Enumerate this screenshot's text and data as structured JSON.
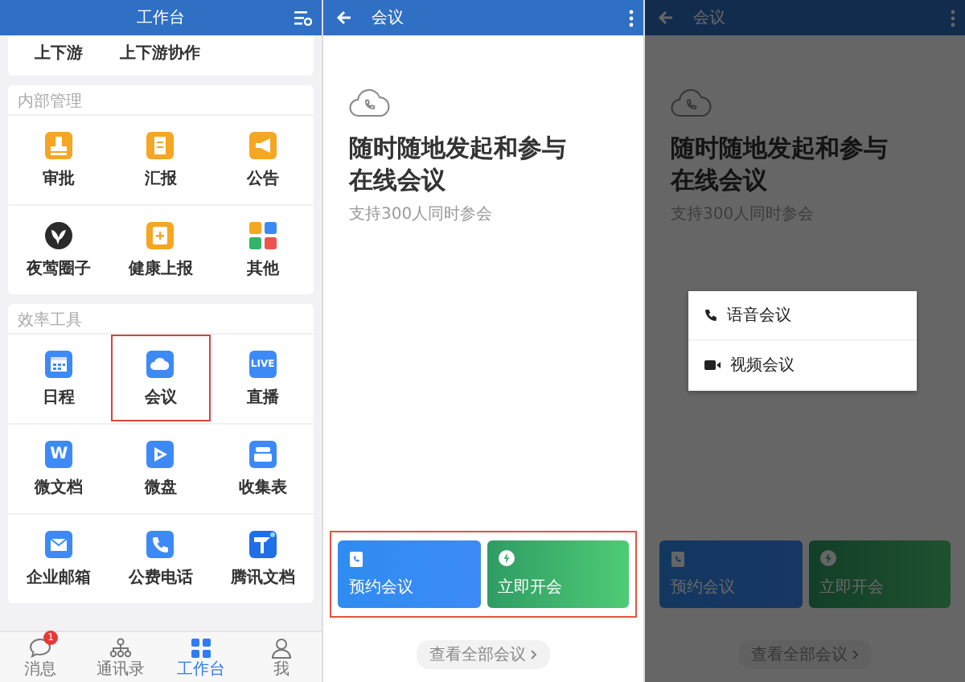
{
  "screens": [
    {
      "kind": "workbench",
      "title": "工作台",
      "top_items": [
        "上下游",
        "上下游协作"
      ],
      "sections": [
        {
          "title": "内部管理",
          "apps": [
            {
              "label": "审批",
              "highlighted": false
            },
            {
              "label": "汇报",
              "highlighted": false
            },
            {
              "label": "公告",
              "highlighted": false
            },
            {
              "label": "夜莺圈子",
              "highlighted": false
            },
            {
              "label": "健康上报",
              "highlighted": false
            },
            {
              "label": "其他",
              "highlighted": false
            }
          ]
        },
        {
          "title": "效率工具",
          "apps": [
            {
              "label": "日程",
              "highlighted": false
            },
            {
              "label": "会议",
              "highlighted": true
            },
            {
              "label": "直播",
              "highlighted": false,
              "icon_text": "LIVE"
            },
            {
              "label": "微文档",
              "highlighted": false,
              "icon_text": "W"
            },
            {
              "label": "微盘",
              "highlighted": false
            },
            {
              "label": "收集表",
              "highlighted": false
            },
            {
              "label": "企业邮箱",
              "highlighted": false
            },
            {
              "label": "公费电话",
              "highlighted": false
            },
            {
              "label": "腾讯文档",
              "highlighted": false
            }
          ]
        }
      ],
      "tabs": [
        {
          "label": "消息",
          "selected": false,
          "badge": "1"
        },
        {
          "label": "通讯录",
          "selected": false
        },
        {
          "label": "工作台",
          "selected": true
        },
        {
          "label": "我",
          "selected": false
        }
      ]
    },
    {
      "kind": "meeting",
      "title": "会议",
      "headline": "随时随地发起和参与在线会议",
      "subline": "支持300人同时参会",
      "actions_highlighted": true,
      "dimmed": false,
      "actions": [
        {
          "label": "预约会议",
          "kind": "schedule"
        },
        {
          "label": "立即开会",
          "kind": "start"
        }
      ],
      "link": "查看全部会议"
    },
    {
      "kind": "meeting",
      "title": "会议",
      "headline": "随时随地发起和参与在线会议",
      "subline": "支持300人同时参会",
      "actions_highlighted": false,
      "dimmed": true,
      "actions": [
        {
          "label": "预约会议",
          "kind": "schedule"
        },
        {
          "label": "立即开会",
          "kind": "start"
        }
      ],
      "link": "查看全部会议",
      "menu": [
        {
          "label": "语音会议",
          "kind": "voice"
        },
        {
          "label": "视频会议",
          "kind": "video"
        }
      ]
    }
  ]
}
